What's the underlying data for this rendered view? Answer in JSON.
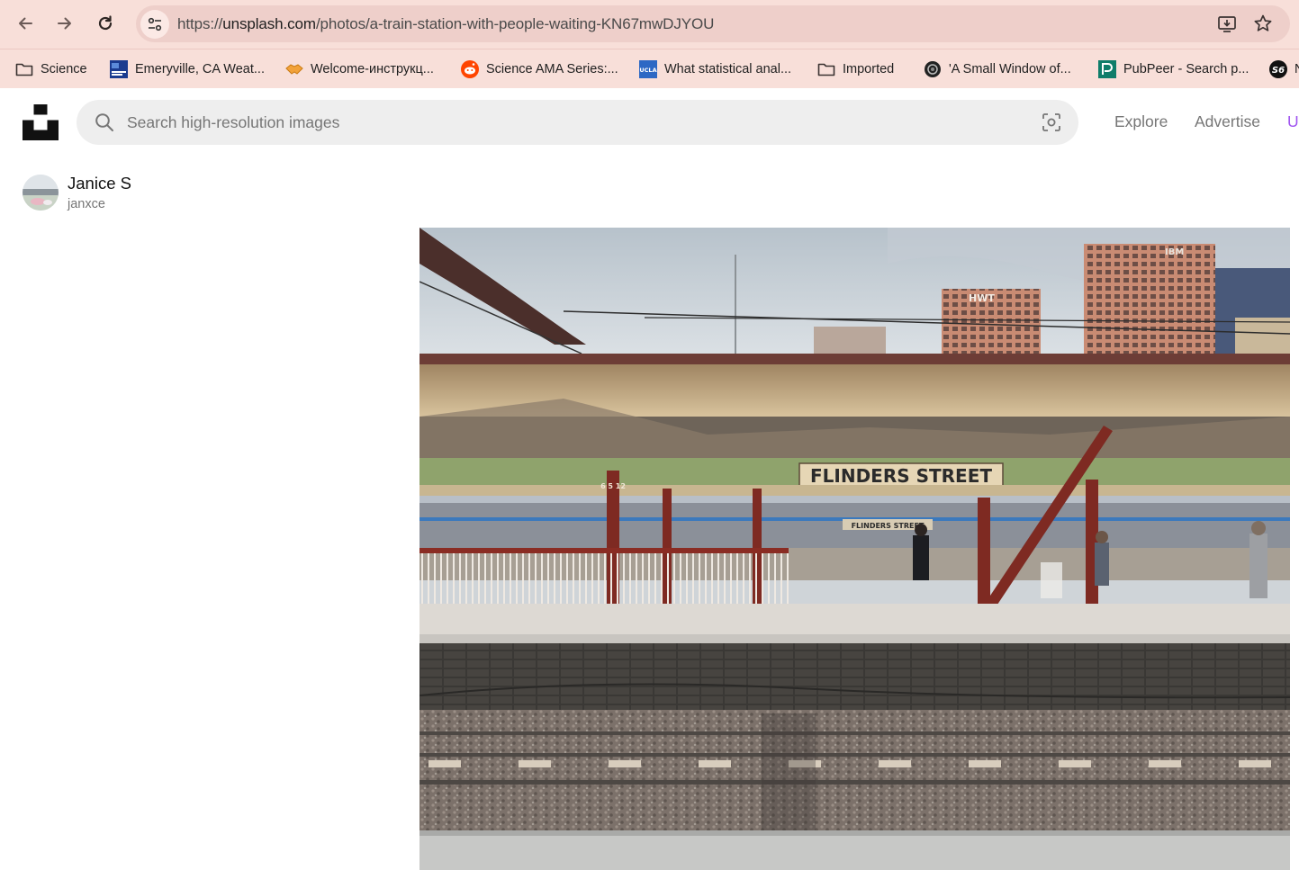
{
  "browser": {
    "url_prefix": "https://",
    "url_domain": "unsplash.com",
    "url_path": "/photos/a-train-station-with-people-waiting-KN67mwDJYOU",
    "bookmarks": [
      {
        "label": "Science",
        "icon": "folder-icon"
      },
      {
        "label": "Emeryville, CA Weat...",
        "icon": "weather-channel-icon"
      },
      {
        "label": "Welcome-инструкц...",
        "icon": "handshake-icon"
      },
      {
        "label": "Science AMA Series:...",
        "icon": "reddit-icon"
      },
      {
        "label": "What statistical anal...",
        "icon": "ucla-icon"
      },
      {
        "label": "Imported",
        "icon": "folder-icon"
      },
      {
        "label": "'A Small Window of...",
        "icon": "camera-lens-icon"
      },
      {
        "label": "PubPeer - Search p...",
        "icon": "pubpeer-icon"
      },
      {
        "label": "N",
        "icon": "s6-icon"
      }
    ]
  },
  "header": {
    "search_placeholder": "Search high-resolution images",
    "nav": {
      "explore": "Explore",
      "advertise": "Advertise",
      "more": "U"
    }
  },
  "author": {
    "name": "Janice S",
    "handle": "janxce"
  },
  "photo": {
    "sign_main": "FLINDERS STREET",
    "sign_far": "FLINDERS STREET",
    "building_sign": "HWT",
    "building_logo": "IBM",
    "pole_number": "6 5 12"
  },
  "colors": {
    "chrome_bg": "#f8dfd9",
    "omnibox_bg": "#eecfca",
    "accent_purple": "#a054f0"
  }
}
